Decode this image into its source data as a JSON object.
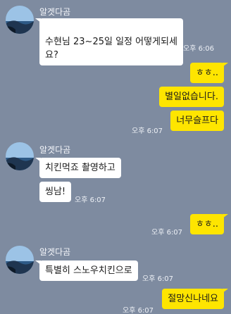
{
  "chat": {
    "sender_name": "알겟다곰",
    "messages": [
      {
        "side": "in",
        "text": "수현님 23~25일 일정 어떻게되세\n요?",
        "time": "오후 6:06"
      },
      {
        "side": "out",
        "text": "ㅎㅎ..",
        "time": ""
      },
      {
        "side": "out",
        "text": "별일없습니다.",
        "time": ""
      },
      {
        "side": "out",
        "text": "너무슬프다",
        "time": "오후 6:07"
      },
      {
        "side": "in",
        "text": "치킨먹죠 촬영하고",
        "time": ""
      },
      {
        "side": "in",
        "text": "씽남!",
        "time": "오후 6:07"
      },
      {
        "side": "out",
        "text": "ㅎㅎ..",
        "time": "오후 6:07"
      },
      {
        "side": "in",
        "text": "특별히 스노우치킨으로",
        "time": "오후 6:07"
      },
      {
        "side": "out",
        "text": "절망신나네요",
        "time": "오후 6:07"
      }
    ]
  },
  "colors": {
    "background": "#7e8ba0",
    "incoming_bubble": "#ffffff",
    "outgoing_bubble": "#fee500"
  },
  "icons": {
    "avatar": "profile-avatar-seascape"
  }
}
